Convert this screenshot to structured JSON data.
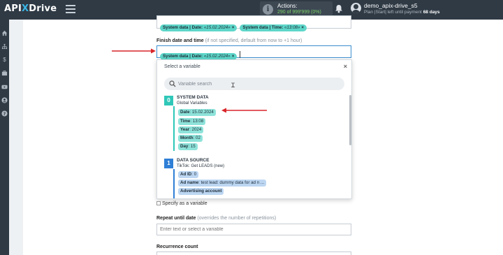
{
  "topbar": {
    "logo_api": "API",
    "logo_x": "X",
    "logo_drive": "Drive",
    "actions_label": "Actions:",
    "actions_count": "290 of 999'999 (0%)",
    "username": "demo_apix-drive_s5",
    "plan_prefix": "Plan |Start| left until payment",
    "plan_days": "68 days"
  },
  "top_field": {
    "chips": [
      {
        "prefix": "System data | Date: ",
        "value": "«15.02.2024»",
        "del": "×"
      },
      {
        "prefix": "System data | Time: ",
        "value": "«13:08»",
        "del": "×"
      }
    ]
  },
  "finish_field": {
    "label": "Finish date and time",
    "hint": "(if not specified, default from now to +1 hour)",
    "chip": {
      "prefix": "System data | Date: ",
      "value": "«15.02.2024»",
      "del": "×"
    }
  },
  "dropdown": {
    "title": "Select a variable",
    "close": "×",
    "search_placeholder": "Variable search",
    "groups": [
      {
        "num": "0",
        "title": "SYSTEM DATA",
        "subtitle": "Global Variables",
        "color": "#2fc7b8",
        "items": [
          {
            "key": "Date",
            "value": ": 15.02.2024"
          },
          {
            "key": "Time",
            "value": ": 13:08"
          },
          {
            "key": "Year",
            "value": ": 2024"
          },
          {
            "key": "Month",
            "value": ": 02"
          },
          {
            "key": "Day",
            "value": ": 15"
          }
        ]
      },
      {
        "num": "1",
        "title": "DATA SOURCE",
        "subtitle": "TikTok: Get LEADS (new)",
        "color": "#2f7fd6",
        "items": [
          {
            "key": "Ad ID",
            "value": ": 0"
          },
          {
            "key": "Ad name",
            "value": ": test lead: dummy data for ad n ..."
          },
          {
            "key": "Advertising account",
            "value": ""
          }
        ]
      }
    ]
  },
  "specify_variable": "Specify as a variable",
  "repeat_until": {
    "label": "Repeat until date",
    "hint": "(overrides the number of repetitions)",
    "placeholder": "Enter text or select a variable"
  },
  "recurrence": {
    "label": "Recurrence count"
  },
  "colors": {
    "topbar": "#2f3a45",
    "chip": "#5ed6c9",
    "arrow": "#d9252a",
    "active_border": "#3a8ecf"
  }
}
